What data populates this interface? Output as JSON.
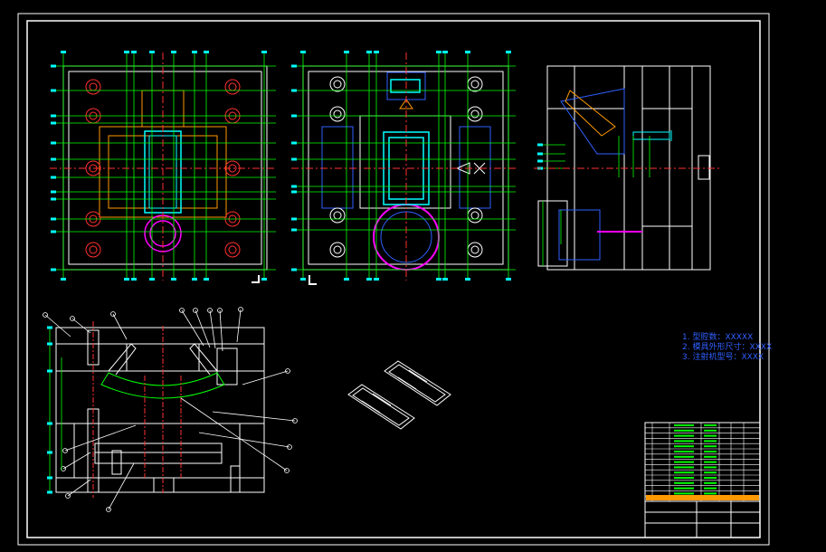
{
  "drawing": {
    "background": "#000000",
    "line_white": "#ffffff",
    "colors": {
      "dimension": "#00ff00",
      "centerline": "#ff3030",
      "cyan": "#00ffff",
      "blue": "#3060ff",
      "magenta": "#ff00ff",
      "yellow": "#ffff00",
      "orange": "#ff9900"
    }
  },
  "notes": [
    {
      "text": "1. 型腔数：XXXXX"
    },
    {
      "text": "2. 模具外形尺寸：XXXX"
    },
    {
      "text": "3. 注射机型号：XXXX"
    }
  ]
}
